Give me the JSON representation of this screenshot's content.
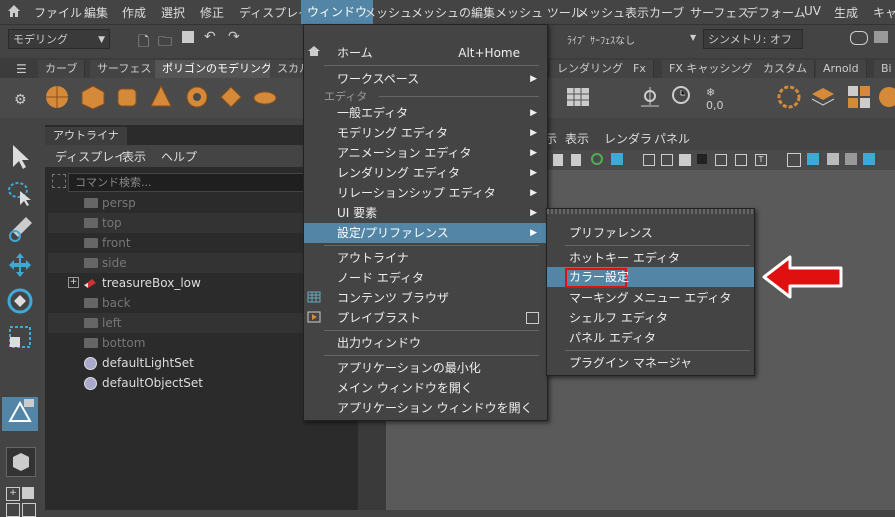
{
  "menubar": {
    "items": [
      "ファイル",
      "編集",
      "作成",
      "選択",
      "修正",
      "ディスプレイ",
      "ウィンドウ",
      "メッシュ",
      "メッシュの編集",
      "メッシュ ツール",
      "メッシュ表示",
      "カーブ",
      "サーフェス",
      "デフォーム",
      "UV",
      "生成",
      "キャ"
    ]
  },
  "toolbar": {
    "mode": "モデリング",
    "live_surface": "ﾗｲﾌﾞ ｻｰﾌｪｽなし",
    "symmetry": "シンメトリ: オフ"
  },
  "shelf": {
    "tabs": [
      "カーブ",
      "サーフェス",
      "ポリゴンのモデリング",
      "スカル",
      "レンダリング",
      "Fx",
      "FX キャッシング",
      "カスタム",
      "Arnold",
      "Bi"
    ]
  },
  "outliner": {
    "title": "アウトライナ",
    "menu": [
      "ディスプレイ",
      "表示",
      "ヘルプ"
    ],
    "search_placeholder": "コマンド検索...",
    "rows": [
      "persp",
      "top",
      "front",
      "side",
      "treasureBox_low",
      "back",
      "left",
      "bottom",
      "defaultLightSet",
      "defaultObjectSet"
    ]
  },
  "viewport": {
    "menu": [
      "示",
      "表示",
      "レンダラ",
      "パネル"
    ]
  },
  "window_menu": {
    "home": "ホーム",
    "home_shortcut": "Alt+Home",
    "workspace": "ワークスペース",
    "editors_category": "エディタ",
    "general_editors": "一般エディタ",
    "modeling_editors": "モデリング エディタ",
    "animation_editors": "アニメーション エディタ",
    "rendering_editors": "レンダリング エディタ",
    "relationship_editors": "リレーションシップ エディタ",
    "ui_elements": "UI 要素",
    "settings_prefs": "設定/プリファレンス",
    "outliner": "アウトライナ",
    "node_editor": "ノード エディタ",
    "content_browser": "コンテンツ ブラウザ",
    "playblast": "プレイブラスト",
    "output_window": "出力ウィンドウ",
    "minimize_app": "アプリケーションの最小化",
    "raise_main": "メイン ウィンドウを開く",
    "raise_app": "アプリケーション ウィンドウを開く"
  },
  "prefs_submenu": {
    "preferences": "プリファレンス",
    "hotkey_editor": "ホットキー エディタ",
    "color_settings": "カラー設定",
    "marking_menu_editor": "マーキング メニュー エディタ",
    "shelf_editor": "シェルフ エディタ",
    "panel_editor": "パネル エディタ",
    "plugin_manager": "プラグイン マネージャ"
  },
  "colors": {
    "accent": "#5285a6",
    "highlight_box": "#e01010",
    "arrow": "#e01010"
  }
}
